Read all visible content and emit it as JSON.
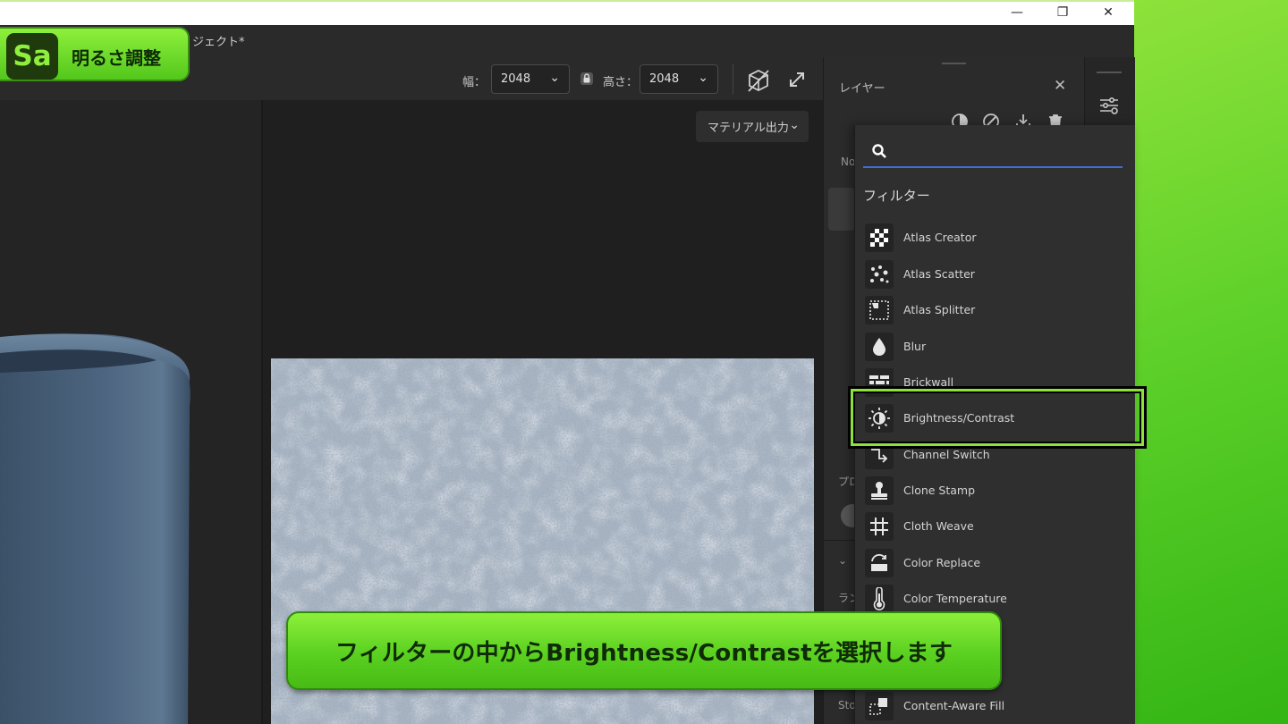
{
  "window": {
    "project_title": "ジェクト*",
    "minimize": "—",
    "restore": "❐",
    "close": "✕"
  },
  "badge": {
    "logo": "Sa",
    "title": "明るさ調整"
  },
  "toolbar": {
    "width_label": "幅：",
    "width_value": "2048",
    "height_label": "高さ：",
    "height_value": "2048"
  },
  "viewport": {
    "material_output_label": "マテリアル出力"
  },
  "layers_panel": {
    "title": "レイヤー",
    "stub_no": "No",
    "stub_pro": "プロ",
    "stub_ran": "ラン",
    "stub_sto": "Sto"
  },
  "filter_menu": {
    "search_placeholder": "",
    "heading": "フィルター",
    "items": [
      {
        "label": "Atlas Creator",
        "icon": "checker-icon"
      },
      {
        "label": "Atlas Scatter",
        "icon": "dots-icon"
      },
      {
        "label": "Atlas Splitter",
        "icon": "splitter-icon"
      },
      {
        "label": "Blur",
        "icon": "drop-icon"
      },
      {
        "label": "Brickwall",
        "icon": "brick-icon"
      },
      {
        "label": "Brightness/Contrast",
        "icon": "sun-icon"
      },
      {
        "label": "Channel Switch",
        "icon": "channel-icon"
      },
      {
        "label": "Clone Stamp",
        "icon": "stamp-icon"
      },
      {
        "label": "Cloth Weave",
        "icon": "weave-icon"
      },
      {
        "label": "Color Replace",
        "icon": "replace-icon"
      },
      {
        "label": "Color Temperature",
        "icon": "thermometer-icon"
      },
      {
        "label": "Content-Aware Fill",
        "icon": "fill-icon"
      }
    ],
    "selected": "Brightness/Contrast",
    "highlight_color": "#8ce23a"
  },
  "caption": {
    "text": "フィルターの中からBrightness/Contrastを選択します"
  }
}
